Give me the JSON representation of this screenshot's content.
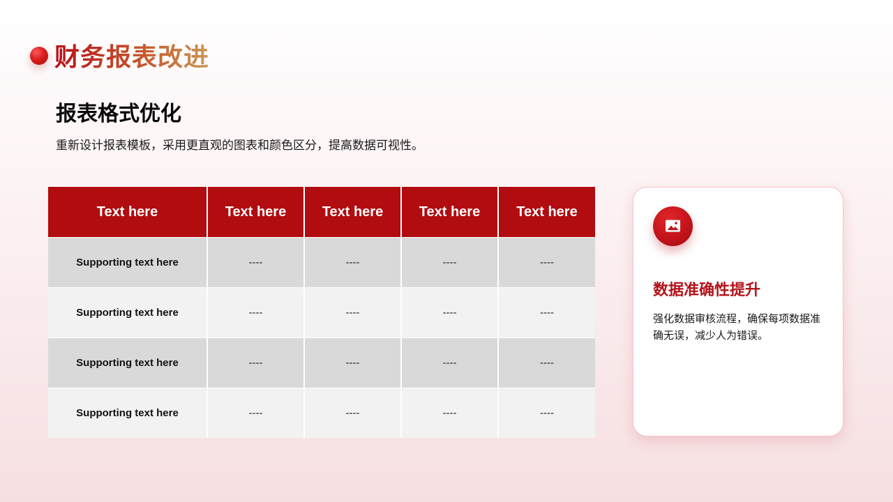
{
  "header": {
    "title": "财务报表改进"
  },
  "section": {
    "heading": "报表格式优化",
    "description": "重新设计报表模板，采用更直观的图表和颜色区分，提高数据可视性。"
  },
  "table": {
    "headers": [
      "Text here",
      "Text here",
      "Text here",
      "Text here",
      "Text here"
    ],
    "rows": [
      [
        "Supporting text here",
        "----",
        "----",
        "----",
        "----"
      ],
      [
        "Supporting text here",
        "----",
        "----",
        "----",
        "----"
      ],
      [
        "Supporting text here",
        "----",
        "----",
        "----",
        "----"
      ],
      [
        "Supporting text here",
        "----",
        "----",
        "----",
        "----"
      ]
    ]
  },
  "card": {
    "icon": "image-icon",
    "title": "数据准确性提升",
    "text": "强化数据审核流程，确保每项数据准确无误，减少人为错误。"
  },
  "colors": {
    "primary_red": "#b10c10",
    "row_dark": "#d9d9d9",
    "row_light": "#f2f2f2",
    "title_gradient_start": "#b4111a",
    "title_gradient_end": "#c89a58"
  }
}
